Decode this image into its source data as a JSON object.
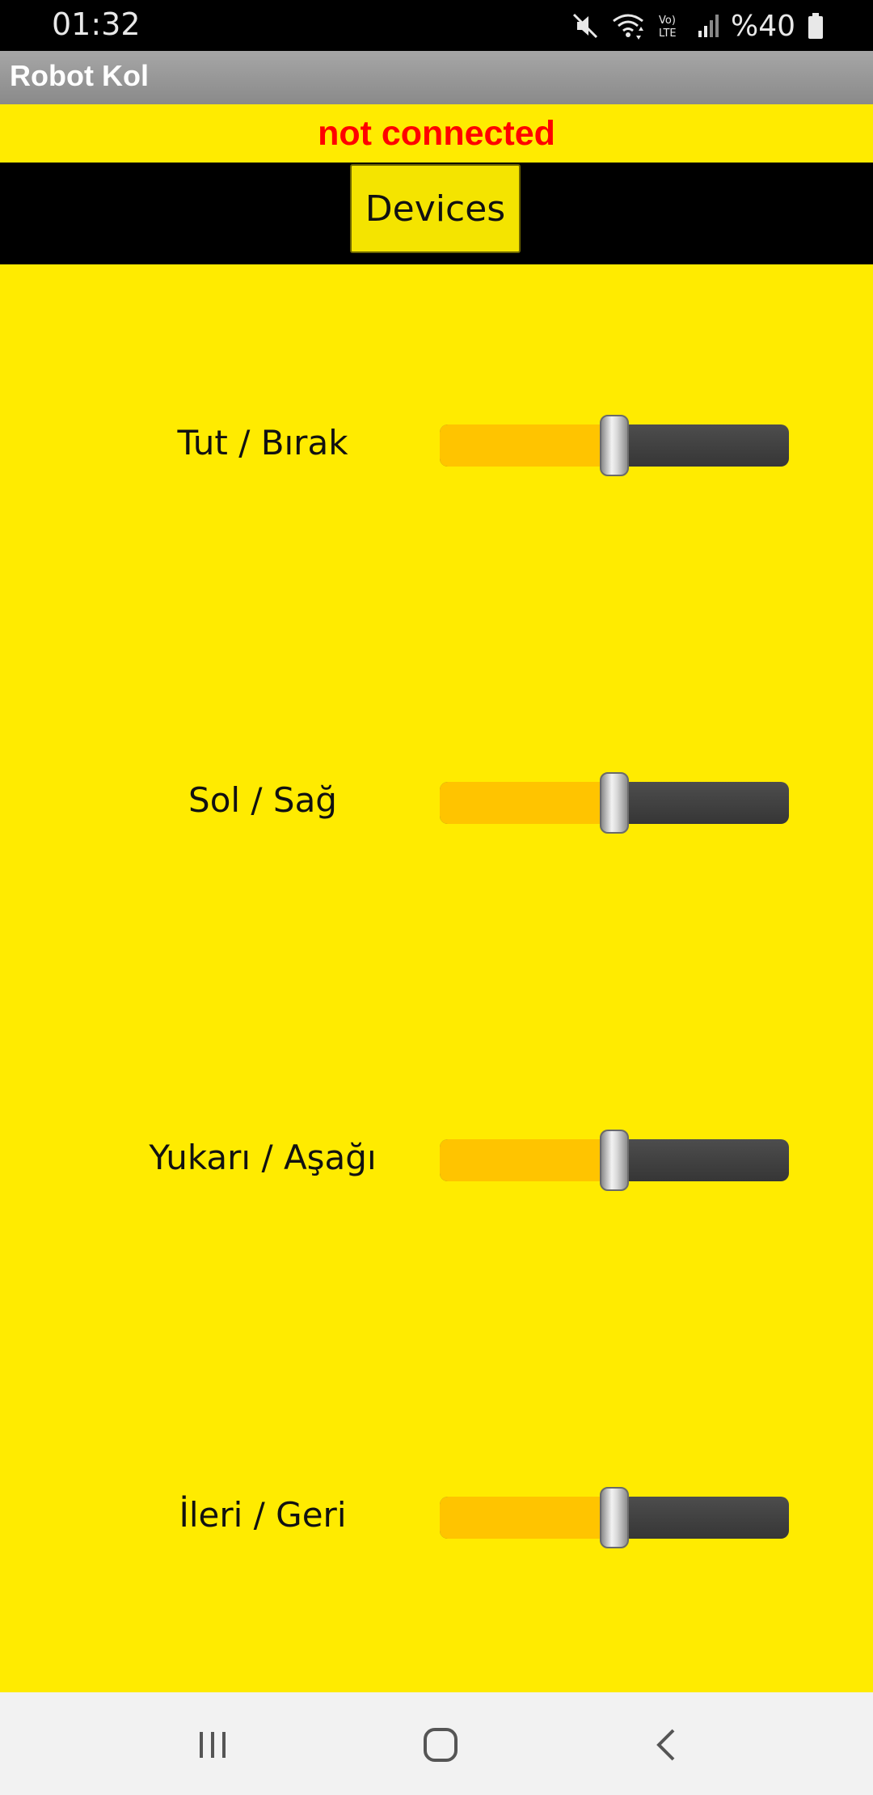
{
  "status_bar": {
    "time": "01:32",
    "battery": "%40",
    "icons": [
      "mute-icon",
      "wifi-icon",
      "volte-icon",
      "signal-icon",
      "battery-icon"
    ]
  },
  "app": {
    "title": "Robot Kol",
    "connection_status": "not connected",
    "devices_label": "Devices"
  },
  "controls": [
    {
      "label": "Tut / Bırak",
      "value": 0.5
    },
    {
      "label": "Sol / Sağ",
      "value": 0.5
    },
    {
      "label": "Yukarı / Aşağı",
      "value": 0.5
    },
    {
      "label": "İleri / Geri",
      "value": 0.5
    }
  ],
  "nav_bar": {
    "buttons": [
      "recent-apps-icon",
      "home-icon",
      "back-icon"
    ]
  },
  "colors": {
    "background": "#FFEB00",
    "status_text": "#FF0000",
    "slider_fill": "#FFC400",
    "slider_track": "#3D3D3D"
  }
}
